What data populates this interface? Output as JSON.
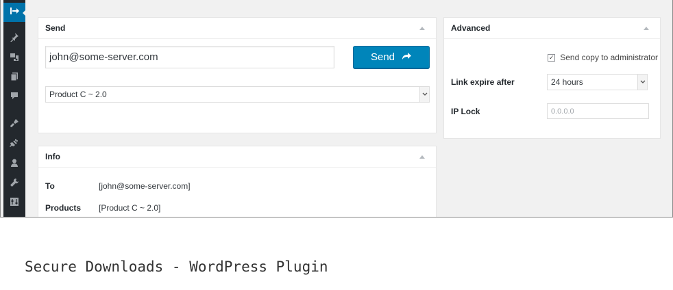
{
  "sidebar": {
    "items": [
      {
        "icon": "collapse-arrow-icon",
        "active": true
      },
      {
        "icon": "pin-icon"
      },
      {
        "icon": "media-icon"
      },
      {
        "icon": "pages-icon"
      },
      {
        "icon": "comments-icon"
      },
      {
        "icon": "appearance-icon"
      },
      {
        "icon": "plugins-icon"
      },
      {
        "icon": "users-icon"
      },
      {
        "icon": "tools-icon"
      },
      {
        "icon": "settings-icon"
      }
    ]
  },
  "send_box": {
    "title": "Send",
    "email_value": "john@some-server.com",
    "send_label": "Send",
    "product_select": "Product C ~ 2.0"
  },
  "advanced_box": {
    "title": "Advanced",
    "send_copy_label": "Send copy to administrator",
    "send_copy_checked": true,
    "link_expire_label": "Link expire after",
    "link_expire_value": "24 hours",
    "ip_lock_label": "IP Lock",
    "ip_lock_placeholder": "0.0.0.0"
  },
  "info_box": {
    "title": "Info",
    "rows": [
      {
        "key": "To",
        "value": "[john@some-server.com]"
      },
      {
        "key": "Products",
        "value": "[Product C ~ 2.0]"
      }
    ]
  },
  "caption": "Secure Downloads - WordPress Plugin",
  "colors": {
    "accent": "#0085ba",
    "sidebar": "#23282d",
    "active": "#0073aa",
    "background": "#f1f1f1"
  }
}
